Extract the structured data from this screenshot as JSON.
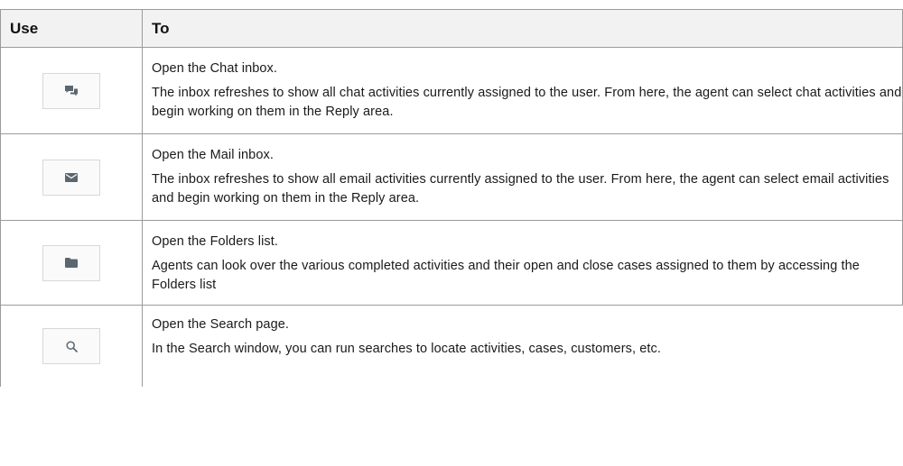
{
  "header": {
    "col_use": "Use",
    "col_to": "To"
  },
  "rows": [
    {
      "icon": "chat-icon",
      "title": "Open the Chat inbox.",
      "desc": "The inbox refreshes to show all chat activities currently assigned to the user. From here, the agent can select chat activities and begin working on them in the Reply area."
    },
    {
      "icon": "mail-icon",
      "title": "Open the Mail inbox.",
      "desc": "The inbox refreshes to show all email activities currently assigned to the user. From here, the agent can select email activities and begin working on them in the Reply area."
    },
    {
      "icon": "folder-icon",
      "title": "Open the Folders list.",
      "desc": "Agents can look over the various completed activities and their open and close cases assigned to them by accessing the Folders list"
    },
    {
      "icon": "search-icon",
      "title": "Open the Search page.",
      "desc": "In the Search window, you can run searches to locate activities, cases, customers, etc."
    }
  ],
  "colors": {
    "border": "#9a9a9a",
    "header_bg": "#f2f2f2",
    "icon": "#5a6770"
  }
}
